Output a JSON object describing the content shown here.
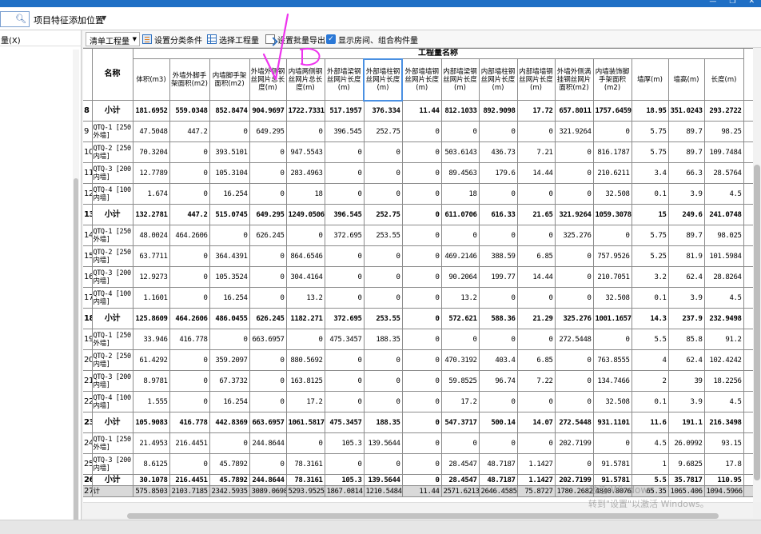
{
  "titlebar": {
    "minimize": "—",
    "restore": "❐",
    "close": "✕"
  },
  "top": {
    "search_icon": "search-icon",
    "project_combo": "项目特征添加位置"
  },
  "left_panel": {
    "label": "量(X)"
  },
  "toolbar": {
    "select_value": "清单工程量",
    "btn_classify": "设置分类条件",
    "btn_choose": "选择工程量",
    "btn_export": "设置批量导出",
    "chk_label": "显示房间、组合构件量"
  },
  "grid": {
    "group_header": "工程量名称",
    "name_header": "名称",
    "columns": [
      "体积(m3)",
      "外墙外脚手架面积(m2)",
      "内墙脚手架面积(m2)",
      "外墙外侧钢丝网片总长度(m)",
      "内墙两侧钢丝网片总长度(m)",
      "外部墙梁钢丝网片长度(m)",
      "外部墙柱钢丝网片长度(m)",
      "外部墙墙钢丝网片长度(m)",
      "内部墙梁钢丝网片长度(m)",
      "内部墙柱钢丝网片长度(m)",
      "内部墙墙钢丝网片长度(m)",
      "外墙外侧满挂钢丝网片面积(m2)",
      "内墙装饰脚手架面积(m2)",
      "墙厚(m)",
      "墙高(m)",
      "长度(m)"
    ],
    "rows": [
      {
        "n": "8",
        "name": "小计",
        "sub": true,
        "v": [
          "181.6952",
          "559.0348",
          "852.8474",
          "904.9697",
          "1722.7331",
          "517.1957",
          "376.334",
          "11.44",
          "812.1033",
          "892.9098",
          "17.72",
          "657.8011",
          "1757.6459",
          "18.95",
          "351.0243",
          "293.2722"
        ]
      },
      {
        "n": "9",
        "name": "QTQ-1 [250 外墙]",
        "v": [
          "47.5048",
          "447.2",
          "0",
          "649.295",
          "0",
          "396.545",
          "252.75",
          "0",
          "0",
          "0",
          "0",
          "321.9264",
          "0",
          "5.75",
          "89.7",
          "98.25"
        ]
      },
      {
        "n": "10",
        "name": "QTQ-2 [250 内墙]",
        "v": [
          "70.3204",
          "0",
          "393.5101",
          "0",
          "947.5543",
          "0",
          "0",
          "0",
          "503.6143",
          "436.73",
          "7.21",
          "0",
          "816.1787",
          "5.75",
          "89.7",
          "109.7484"
        ]
      },
      {
        "n": "11",
        "name": "QTQ-3 [200 内墙]",
        "v": [
          "12.7789",
          "0",
          "105.3104",
          "0",
          "283.4963",
          "0",
          "0",
          "0",
          "89.4563",
          "179.6",
          "14.44",
          "0",
          "210.6211",
          "3.4",
          "66.3",
          "28.5764"
        ]
      },
      {
        "n": "12",
        "name": "QTQ-4 [100 内墙]",
        "v": [
          "1.674",
          "0",
          "16.254",
          "0",
          "18",
          "0",
          "0",
          "0",
          "18",
          "0",
          "0",
          "0",
          "32.508",
          "0.1",
          "3.9",
          "4.5"
        ]
      },
      {
        "n": "13",
        "name": "小计",
        "sub": true,
        "v": [
          "132.2781",
          "447.2",
          "515.0745",
          "649.295",
          "1249.0506",
          "396.545",
          "252.75",
          "0",
          "611.0706",
          "616.33",
          "21.65",
          "321.9264",
          "1059.3078",
          "15",
          "249.6",
          "241.0748"
        ]
      },
      {
        "n": "14",
        "name": "QTQ-1 [250 外墙]",
        "v": [
          "48.0024",
          "464.2606",
          "0",
          "626.245",
          "0",
          "372.695",
          "253.55",
          "0",
          "0",
          "0",
          "0",
          "325.276",
          "0",
          "5.75",
          "89.7",
          "98.025"
        ]
      },
      {
        "n": "15",
        "name": "QTQ-2 [250 内墙]",
        "v": [
          "63.7711",
          "0",
          "364.4391",
          "0",
          "864.6546",
          "0",
          "0",
          "0",
          "469.2146",
          "388.59",
          "6.85",
          "0",
          "757.9526",
          "5.25",
          "81.9",
          "101.5984"
        ]
      },
      {
        "n": "16",
        "name": "QTQ-3 [200 内墙]",
        "v": [
          "12.9273",
          "0",
          "105.3524",
          "0",
          "304.4164",
          "0",
          "0",
          "0",
          "90.2064",
          "199.77",
          "14.44",
          "0",
          "210.7051",
          "3.2",
          "62.4",
          "28.8264"
        ]
      },
      {
        "n": "17",
        "name": "QTQ-4 [100 内墙]",
        "v": [
          "1.1601",
          "0",
          "16.254",
          "0",
          "13.2",
          "0",
          "0",
          "0",
          "13.2",
          "0",
          "0",
          "0",
          "32.508",
          "0.1",
          "3.9",
          "4.5"
        ]
      },
      {
        "n": "18",
        "name": "小计",
        "sub": true,
        "v": [
          "125.8609",
          "464.2606",
          "486.0455",
          "626.245",
          "1182.271",
          "372.695",
          "253.55",
          "0",
          "572.621",
          "588.36",
          "21.29",
          "325.276",
          "1001.1657",
          "14.3",
          "237.9",
          "232.9498"
        ]
      },
      {
        "n": "19",
        "name": "QTQ-1 [250 外墙]",
        "v": [
          "33.946",
          "416.778",
          "0",
          "663.6957",
          "0",
          "475.3457",
          "188.35",
          "0",
          "0",
          "0",
          "0",
          "272.5448",
          "0",
          "5.5",
          "85.8",
          "91.2"
        ]
      },
      {
        "n": "20",
        "name": "QTQ-2 [250 内墙]",
        "v": [
          "61.4292",
          "0",
          "359.2097",
          "0",
          "880.5692",
          "0",
          "0",
          "0",
          "470.3192",
          "403.4",
          "6.85",
          "0",
          "763.8555",
          "4",
          "62.4",
          "102.4242"
        ]
      },
      {
        "n": "21",
        "name": "QTQ-3 [200 内墙]",
        "v": [
          "8.9781",
          "0",
          "67.3732",
          "0",
          "163.8125",
          "0",
          "0",
          "0",
          "59.8525",
          "96.74",
          "7.22",
          "0",
          "134.7466",
          "2",
          "39",
          "18.2256"
        ]
      },
      {
        "n": "22",
        "name": "QTQ-4 [100 内墙]",
        "v": [
          "1.555",
          "0",
          "16.254",
          "0",
          "17.2",
          "0",
          "0",
          "0",
          "17.2",
          "0",
          "0",
          "0",
          "32.508",
          "0.1",
          "3.9",
          "4.5"
        ]
      },
      {
        "n": "23",
        "name": "小计",
        "sub": true,
        "v": [
          "105.9083",
          "416.778",
          "442.8369",
          "663.6957",
          "1061.5817",
          "475.3457",
          "188.35",
          "0",
          "547.3717",
          "500.14",
          "14.07",
          "272.5448",
          "931.1101",
          "11.6",
          "191.1",
          "216.3498"
        ]
      },
      {
        "n": "24",
        "name": "QTQ-1 [250 外墙]",
        "v": [
          "21.4953",
          "216.4451",
          "0",
          "244.8644",
          "0",
          "105.3",
          "139.5644",
          "0",
          "0",
          "0",
          "0",
          "202.7199",
          "0",
          "4.5",
          "26.0992",
          "93.15"
        ]
      },
      {
        "n": "25",
        "name": "QTQ-3 [200 内墙]",
        "v": [
          "8.6125",
          "0",
          "45.7892",
          "0",
          "78.3161",
          "0",
          "0",
          "0",
          "28.4547",
          "48.7187",
          "1.1427",
          "0",
          "91.5781",
          "1",
          "9.6825",
          "17.8"
        ]
      },
      {
        "n": "26",
        "name": "小计",
        "sub": true,
        "short": true,
        "v": [
          "30.1078",
          "216.4451",
          "45.7892",
          "244.8644",
          "78.3161",
          "105.3",
          "139.5644",
          "0",
          "28.4547",
          "48.7187",
          "1.1427",
          "202.7199",
          "91.5781",
          "5.5",
          "35.7817",
          "110.95"
        ]
      },
      {
        "n": "27",
        "name": "计",
        "total": true,
        "v": [
          "575.8503",
          "2103.7185",
          "2342.5935",
          "3089.0698",
          "5293.9525",
          "1867.0814",
          "1210.5484",
          "11.44",
          "2571.6213",
          "2646.4585",
          "75.8727",
          "1780.2682",
          "4840.8076",
          "65.35",
          "1065.406",
          "1094.5966"
        ]
      }
    ]
  },
  "watermark": {
    "line1": "激活 Windows",
    "line2": "转到\"设置\"以激活 Windows。"
  },
  "colors": {
    "titlebar": "#1f6fc5",
    "selected_header_border": "#4a90e2",
    "total_row": "#d9d9d9",
    "annotation_ink": "#ee33ee"
  }
}
